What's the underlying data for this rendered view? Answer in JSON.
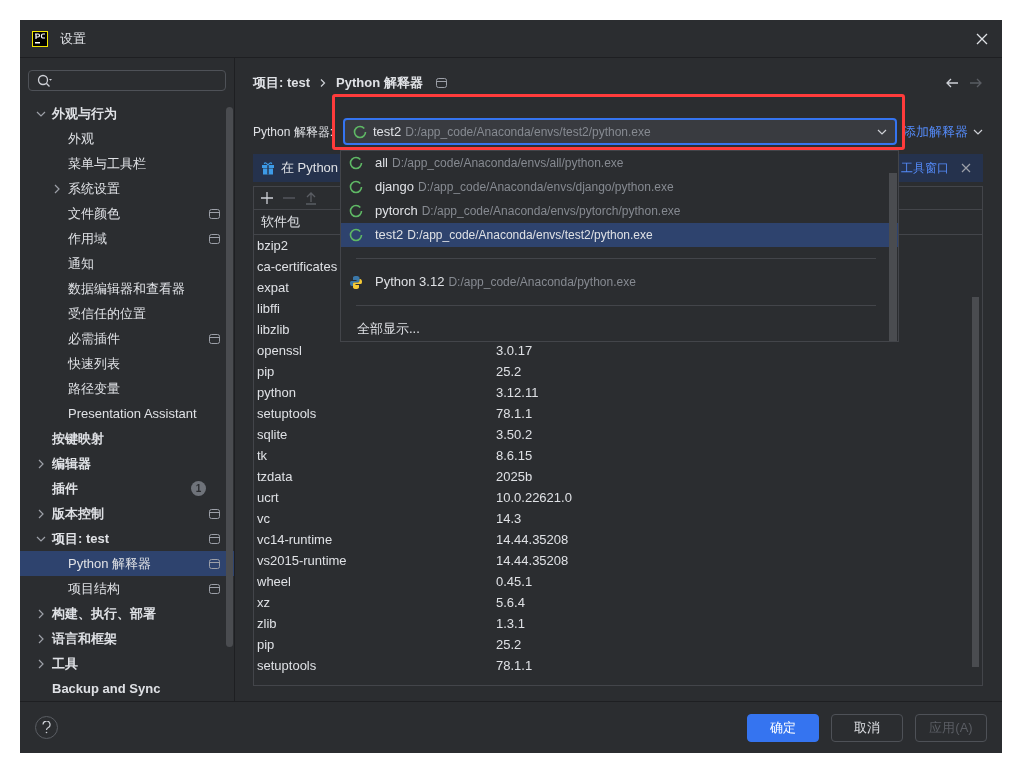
{
  "window": {
    "title": "设置"
  },
  "sidebar": {
    "items": [
      {
        "label": "外观与行为",
        "expanded": true,
        "selected": false,
        "scoped": false,
        "children": [
          {
            "label": "外观",
            "selected": false,
            "scoped": false
          },
          {
            "label": "菜单与工具栏",
            "selected": false,
            "scoped": false
          },
          {
            "label": "系统设置",
            "expanded": false,
            "selected": false,
            "scoped": false
          },
          {
            "label": "文件颜色",
            "selected": false,
            "scoped": true
          },
          {
            "label": "作用域",
            "selected": false,
            "scoped": true
          },
          {
            "label": "通知",
            "selected": false,
            "scoped": false
          },
          {
            "label": "数据编辑器和查看器",
            "selected": false,
            "scoped": false
          },
          {
            "label": "受信任的位置",
            "selected": false,
            "scoped": false
          },
          {
            "label": "必需插件",
            "selected": false,
            "scoped": true
          },
          {
            "label": "快速列表",
            "selected": false,
            "scoped": false
          },
          {
            "label": "路径变量",
            "selected": false,
            "scoped": false
          },
          {
            "label": "Presentation Assistant",
            "selected": false,
            "scoped": false
          }
        ]
      },
      {
        "label": "按键映射",
        "selected": false,
        "scoped": false
      },
      {
        "label": "编辑器",
        "expanded": false,
        "selected": false,
        "scoped": false
      },
      {
        "label": "插件",
        "selected": false,
        "scoped": false,
        "badge": "1"
      },
      {
        "label": "版本控制",
        "expanded": false,
        "selected": false,
        "scoped": true
      },
      {
        "label": "项目: test",
        "expanded": true,
        "selected": false,
        "scoped": true,
        "children": [
          {
            "label": "Python 解释器",
            "selected": true,
            "scoped": true
          },
          {
            "label": "项目结构",
            "selected": false,
            "scoped": true
          }
        ]
      },
      {
        "label": "构建、执行、部署",
        "expanded": false,
        "selected": false,
        "scoped": false
      },
      {
        "label": "语言和框架",
        "expanded": false,
        "selected": false,
        "scoped": false
      },
      {
        "label": "工具",
        "expanded": false,
        "selected": false,
        "scoped": false
      },
      {
        "label": "Backup and Sync",
        "selected": false,
        "scoped": false
      }
    ]
  },
  "breadcrumb": [
    "项目: test",
    "Python 解释器"
  ],
  "navigation": [
    {
      "kind": "back",
      "disabled": false
    },
    {
      "kind": "forward",
      "disabled": true
    }
  ],
  "interpreter": {
    "label": "Python 解释器:",
    "name": "test2",
    "path": "D:/app_code/Anaconda/envs/test2/python.exe",
    "add_link": "添加解释器"
  },
  "banner": {
    "text_start": "在 Python",
    "text_end": "工具窗口"
  },
  "table": {
    "toolbar": [
      {
        "kind": "add",
        "disabled": false
      },
      {
        "kind": "remove",
        "disabled": true
      },
      {
        "kind": "upgrade",
        "disabled": true
      }
    ],
    "columns": [
      "软件包"
    ],
    "rows": [
      {
        "package": "bzip2"
      },
      {
        "package": "ca-certificates"
      },
      {
        "package": "expat"
      },
      {
        "package": "libffi"
      },
      {
        "package": "libzlib"
      },
      {
        "package": "openssl",
        "version": "3.0.17"
      },
      {
        "package": "pip",
        "version": "25.2"
      },
      {
        "package": "python",
        "version": "3.12.11"
      },
      {
        "package": "setuptools",
        "version": "78.1.1"
      },
      {
        "package": "sqlite",
        "version": "3.50.2"
      },
      {
        "package": "tk",
        "version": "8.6.15"
      },
      {
        "package": "tzdata",
        "version": "2025b"
      },
      {
        "package": "ucrt",
        "version": "10.0.22621.0"
      },
      {
        "package": "vc",
        "version": "14.3"
      },
      {
        "package": "vc14-runtime",
        "version": "14.44.35208"
      },
      {
        "package": "vs2015-runtime",
        "version": "14.44.35208"
      },
      {
        "package": "wheel",
        "version": "0.45.1"
      },
      {
        "package": "xz",
        "version": "5.6.4"
      },
      {
        "package": "zlib",
        "version": "1.3.1"
      },
      {
        "package": "pip",
        "version": "25.2"
      },
      {
        "package": "setuptools",
        "version": "78.1.1"
      }
    ]
  },
  "dropdown": {
    "groups": [
      [
        {
          "kind": "conda",
          "name": "all",
          "path": "D:/app_code/Anaconda/envs/all/python.exe",
          "selected": false
        },
        {
          "kind": "conda",
          "name": "django",
          "path": "D:/app_code/Anaconda/envs/django/python.exe",
          "selected": false
        },
        {
          "kind": "conda",
          "name": "pytorch",
          "path": "D:/app_code/Anaconda/envs/pytorch/python.exe",
          "selected": false
        },
        {
          "kind": "conda",
          "name": "test2",
          "path": "D:/app_code/Anaconda/envs/test2/python.exe",
          "selected": true
        }
      ],
      [
        {
          "kind": "system",
          "name": "Python 3.12",
          "path": "D:/app_code/Anaconda/python.exe",
          "selected": false
        }
      ]
    ],
    "show_all": "全部显示..."
  },
  "footer": {
    "buttons": [
      {
        "label": "确定",
        "kind": "primary",
        "disabled": false
      },
      {
        "label": "取消",
        "kind": "secondary",
        "disabled": false
      },
      {
        "label": "应用(A)",
        "kind": "secondary",
        "disabled": true
      }
    ]
  }
}
